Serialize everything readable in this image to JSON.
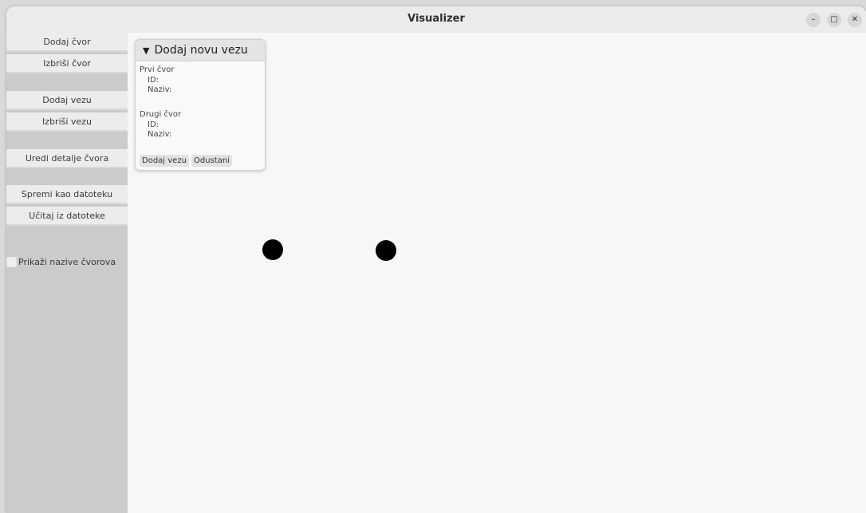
{
  "window": {
    "title": "Visualizer",
    "controls": {
      "minimize": "–",
      "maximize": "□",
      "close": "✕"
    }
  },
  "sidebar": {
    "add_node": "Dodaj čvor",
    "delete_node": "Izbriši čvor",
    "add_edge": "Dodaj vezu",
    "delete_edge": "Izbriši vezu",
    "edit_node": "Uredi detalje čvora",
    "save_file": "Spremi kao datoteku",
    "load_file": "Učitaj iz datoteke",
    "show_names_label": "Prikaži nazive čvorova",
    "show_names_checked": false
  },
  "panel": {
    "collapse_icon": "▼",
    "title": "Dodaj novu vezu",
    "first_node_label": "Prvi čvor",
    "first_id_label": "ID:",
    "first_name_label": "Naziv:",
    "second_node_label": "Drugi čvor",
    "second_id_label": "ID:",
    "second_name_label": "Naziv:",
    "add_button": "Dodaj vezu",
    "cancel_button": "Odustani"
  },
  "colors": {
    "node": "#000000",
    "sidebar_bg": "#cbcbcb",
    "canvas_bg": "#f7f7f7"
  }
}
